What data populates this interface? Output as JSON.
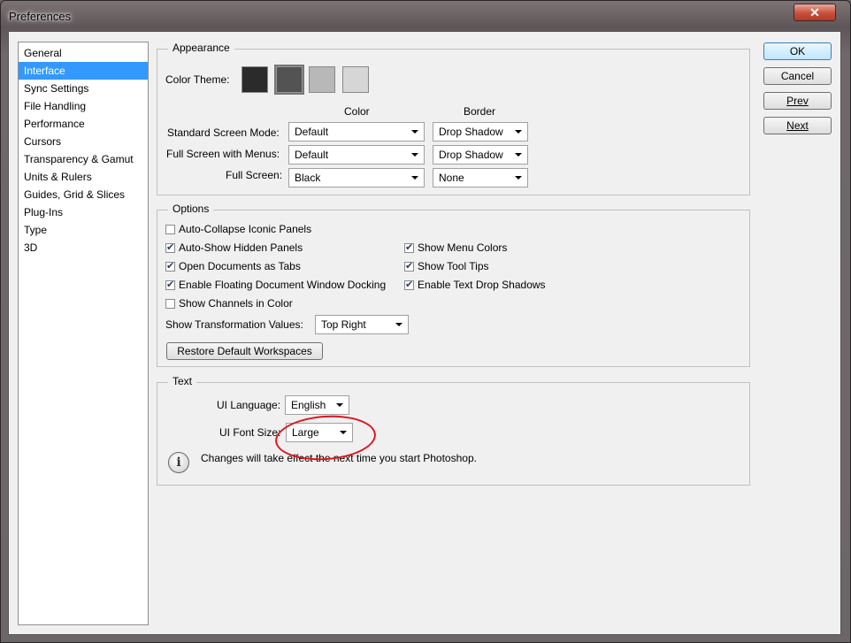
{
  "window": {
    "title": "Preferences",
    "close_glyph": "✕"
  },
  "nav": {
    "items": [
      {
        "label": "General",
        "selected": false
      },
      {
        "label": "Interface",
        "selected": true
      },
      {
        "label": "Sync Settings",
        "selected": false
      },
      {
        "label": "File Handling",
        "selected": false
      },
      {
        "label": "Performance",
        "selected": false
      },
      {
        "label": "Cursors",
        "selected": false
      },
      {
        "label": "Transparency & Gamut",
        "selected": false
      },
      {
        "label": "Units & Rulers",
        "selected": false
      },
      {
        "label": "Guides, Grid & Slices",
        "selected": false
      },
      {
        "label": "Plug-Ins",
        "selected": false
      },
      {
        "label": "Type",
        "selected": false
      },
      {
        "label": "3D",
        "selected": false
      }
    ]
  },
  "appearance": {
    "title": "Appearance",
    "color_theme_label": "Color Theme:",
    "themes": [
      "#2b2b2b",
      "#535353",
      "#b8b8b8",
      "#d6d6d6"
    ],
    "col_color": "Color",
    "col_border": "Border",
    "rows": [
      {
        "label": "Standard Screen Mode:",
        "color": "Default",
        "border": "Drop Shadow"
      },
      {
        "label": "Full Screen with Menus:",
        "color": "Default",
        "border": "Drop Shadow"
      },
      {
        "label": "Full Screen:",
        "color": "Black",
        "border": "None"
      }
    ]
  },
  "options": {
    "title": "Options",
    "auto_collapse": "Auto-Collapse Iconic Panels",
    "auto_show": "Auto-Show Hidden Panels",
    "open_tabs": "Open Documents as Tabs",
    "floating_docking": "Enable Floating Document Window Docking",
    "channels_color": "Show Channels in Color",
    "menu_colors": "Show Menu Colors",
    "tool_tips": "Show Tool Tips",
    "text_shadows": "Enable Text Drop Shadows",
    "transform_label": "Show Transformation Values:",
    "transform_value": "Top Right",
    "restore_button": "Restore Default Workspaces"
  },
  "text": {
    "title": "Text",
    "language_label": "UI Language:",
    "language_value": "English",
    "font_size_label": "UI Font Size:",
    "font_size_value": "Large",
    "info_glyph": "i",
    "info_message": "Changes will take effect the next time you start Photoshop."
  },
  "buttons": {
    "ok": "OK",
    "cancel": "Cancel",
    "prev": "Prev",
    "next": "Next"
  },
  "annotation_color": "#e0141b"
}
